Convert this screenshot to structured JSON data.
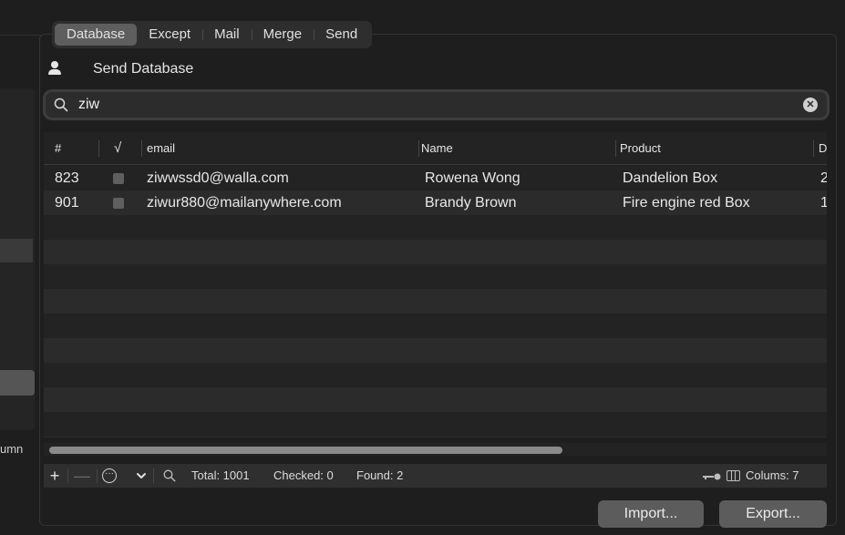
{
  "tabs": [
    "Database",
    "Except",
    "Mail",
    "Merge",
    "Send"
  ],
  "active_tab": "Database",
  "heading": "Send Database",
  "left_panel": {
    "label_fragment": "umn"
  },
  "search": {
    "value": "ziw"
  },
  "table": {
    "columns": [
      "#",
      "√",
      "email",
      "Name",
      "Product",
      "D"
    ],
    "rows": [
      {
        "num": "823",
        "checked": false,
        "email": "ziwwssd0@walla.com",
        "name": "Rowena Wong",
        "product": "Dandelion Box",
        "d": "2"
      },
      {
        "num": "901",
        "checked": false,
        "email": "ziwur880@mailanywhere.com",
        "name": "Brandy Brown",
        "product": "Fire engine red Box",
        "d": "1"
      }
    ],
    "empty_rows": 10
  },
  "status": {
    "total": "Total: 1001",
    "checked": "Checked: 0",
    "found": "Found: 2",
    "columns": "Colums: 7"
  },
  "buttons": {
    "import": "Import...",
    "export": "Export..."
  },
  "icons": [
    "person-icon",
    "search-icon",
    "clear-icon",
    "plus-icon",
    "minus-icon",
    "ellipsis-icon",
    "chevron-down-icon",
    "key-icon",
    "columns-icon"
  ]
}
